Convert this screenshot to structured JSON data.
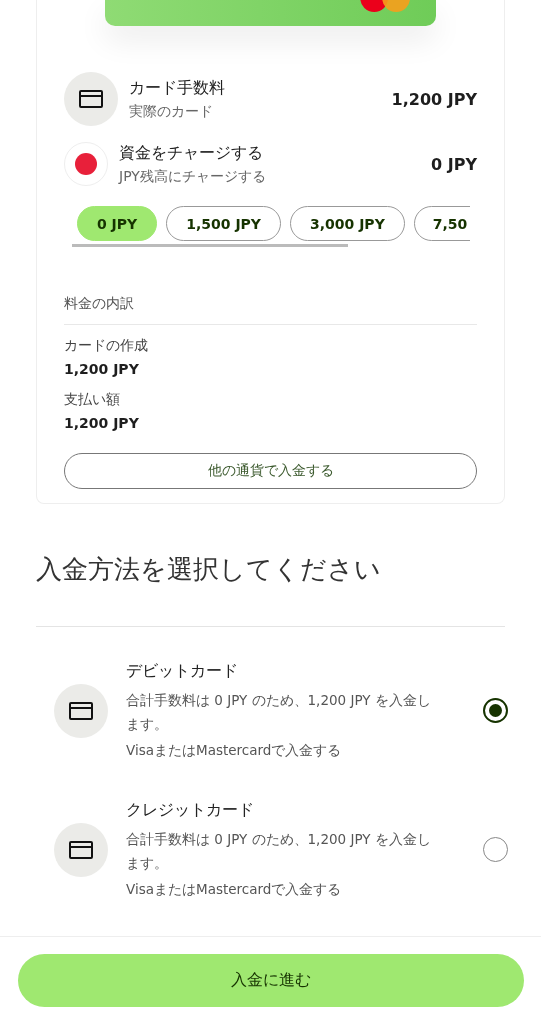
{
  "fees": [
    {
      "kind": "card",
      "title": "カード手数料",
      "subtitle": "実際のカード",
      "amount": "1,200 JPY"
    },
    {
      "kind": "flag",
      "title": "資金をチャージする",
      "subtitle": "JPY残高にチャージする",
      "amount": "0 JPY"
    }
  ],
  "amount_chips": [
    {
      "label": "0 JPY",
      "selected": true
    },
    {
      "label": "1,500 JPY",
      "selected": false
    },
    {
      "label": "3,000 JPY",
      "selected": false
    },
    {
      "label": "7,50",
      "selected": false
    }
  ],
  "breakdown": {
    "title": "料金の内訳",
    "items": [
      {
        "label": "カードの作成",
        "value": "1,200 JPY"
      },
      {
        "label": "支払い額",
        "value": "1,200 JPY"
      }
    ]
  },
  "other_currency_button": "他の通貨で入金する",
  "heading": "入金方法を選択してください",
  "methods": [
    {
      "title": "デビットカード",
      "description": "合計手数料は 0 JPY のため、1,200 JPY を入金します。",
      "note": "VisaまたはMastercardで入金する",
      "selected": true
    },
    {
      "title": "クレジットカード",
      "description": "合計手数料は 0 JPY のため、1,200 JPY を入金します。",
      "note": "VisaまたはMastercardで入金する",
      "selected": false
    }
  ],
  "continue_button": "入金に進む"
}
